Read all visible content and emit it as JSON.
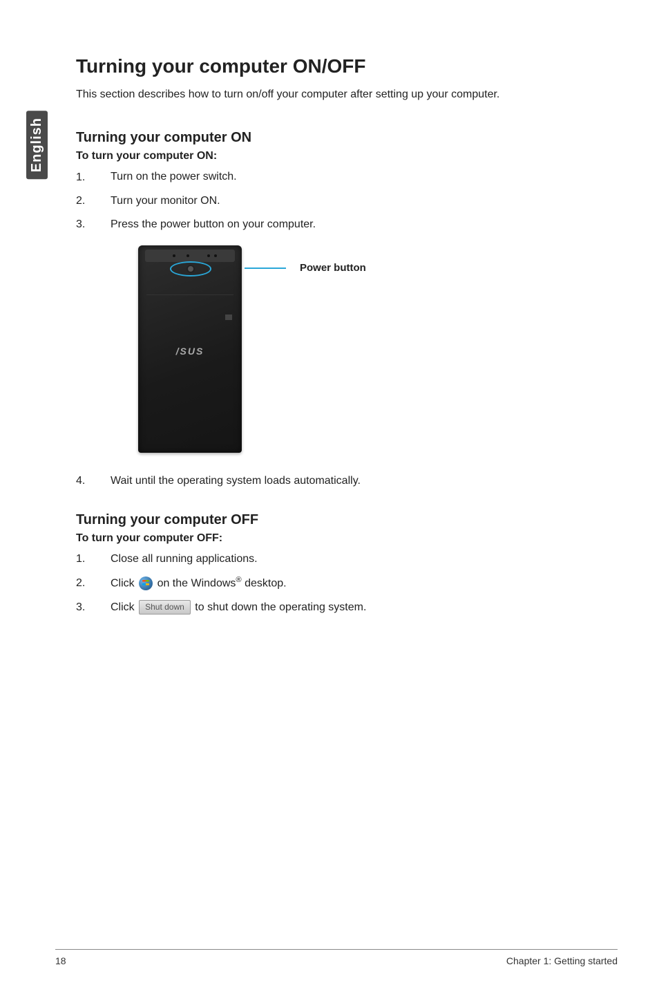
{
  "side_tab": "English",
  "main_title": "Turning your computer ON/OFF",
  "intro": "This section describes how to turn on/off your computer after setting up your computer.",
  "section_on": {
    "heading": "Turning your computer ON",
    "subheading": "To turn your computer ON:",
    "steps": [
      {
        "num": "1.",
        "text": "Turn on the power switch."
      },
      {
        "num": "2.",
        "text": "Turn your monitor ON."
      },
      {
        "num": "3.",
        "text": "Press the power button on your computer."
      }
    ],
    "step4": {
      "num": "4.",
      "text": "Wait until the operating system loads automatically."
    }
  },
  "figure": {
    "callout": "Power button",
    "logo": "/SUS"
  },
  "section_off": {
    "heading": "Turning your computer OFF",
    "subheading": "To turn your computer OFF:",
    "steps": [
      {
        "num": "1.",
        "text": "Close all running applications."
      },
      {
        "num": "2.",
        "pre": "Click ",
        "post": " on the Windows",
        "reg": "®",
        "tail": " desktop."
      },
      {
        "num": "3.",
        "pre": "Click ",
        "btn": "Shut down",
        "post": " to shut down the operating system."
      }
    ]
  },
  "footer": {
    "page": "18",
    "chapter": "Chapter 1: Getting started"
  }
}
